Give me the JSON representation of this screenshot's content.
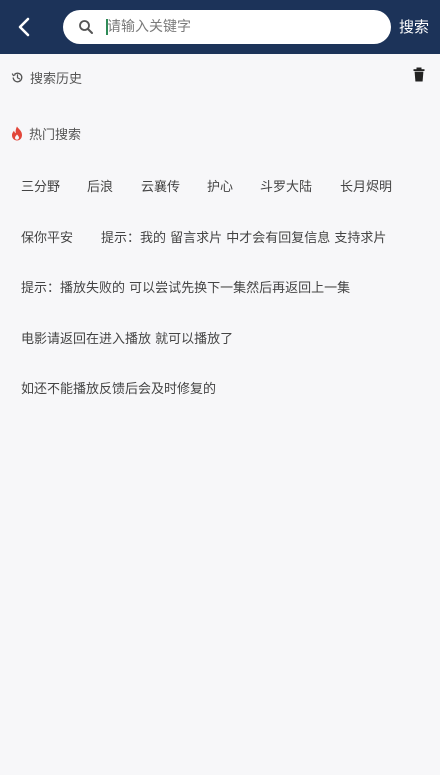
{
  "header": {
    "search_placeholder": "请输入关键字",
    "search_button_label": "搜索",
    "background_color": "#1c3359"
  },
  "history": {
    "title": "搜索历史",
    "icon": "history-icon",
    "delete_icon": "trash-icon"
  },
  "hot": {
    "title": "热门搜索",
    "icon": "fire-icon",
    "icon_color": "#e2463a",
    "items": [
      "三分野",
      "后浪",
      "云襄传",
      "护心",
      "斗罗大陆",
      "长月烬明",
      "保你平安",
      "提示：我的 留言求片 中才会有回复信息 支持求片",
      "提示：播放失败的 可以尝试先换下一集然后再返回上一集",
      "电影请返回在进入播放 就可以播放了",
      "如还不能播放反馈后会及时修复的"
    ]
  }
}
